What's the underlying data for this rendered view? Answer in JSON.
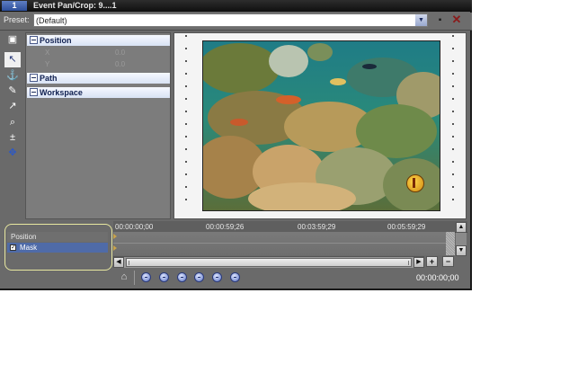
{
  "window": {
    "number": "1",
    "title": "Event Pan/Crop: 9....1"
  },
  "preset": {
    "label": "Preset:",
    "value": "(Default)"
  },
  "tools": [
    {
      "name": "normal-edit-tool-icon"
    },
    {
      "name": "select-tool-icon"
    },
    {
      "name": "anchor-tool-icon"
    },
    {
      "name": "pen-tool-icon"
    },
    {
      "name": "pointer-tool-icon"
    },
    {
      "name": "zoom-tool-icon"
    },
    {
      "name": "zoom-reset-icon"
    },
    {
      "name": "move-tool-icon"
    }
  ],
  "tree": {
    "position": "Position",
    "position_rows": [
      {
        "label": "X",
        "value": "0.0"
      },
      {
        "label": "Y",
        "value": "0.0"
      }
    ],
    "path": "Path",
    "workspace": "Workspace"
  },
  "timeline": {
    "ticks": [
      "00:00:00;00",
      "00:00:59;26",
      "00:03:59;29",
      "00:05:59;29"
    ],
    "timecode": "00:00:00;00"
  },
  "layers": {
    "header": "Position",
    "mask": "Mask"
  },
  "colors": {
    "window_bg": "#6a6a6a",
    "highlight": "#e8e8a0",
    "selected_row": "#4f6ba8"
  }
}
